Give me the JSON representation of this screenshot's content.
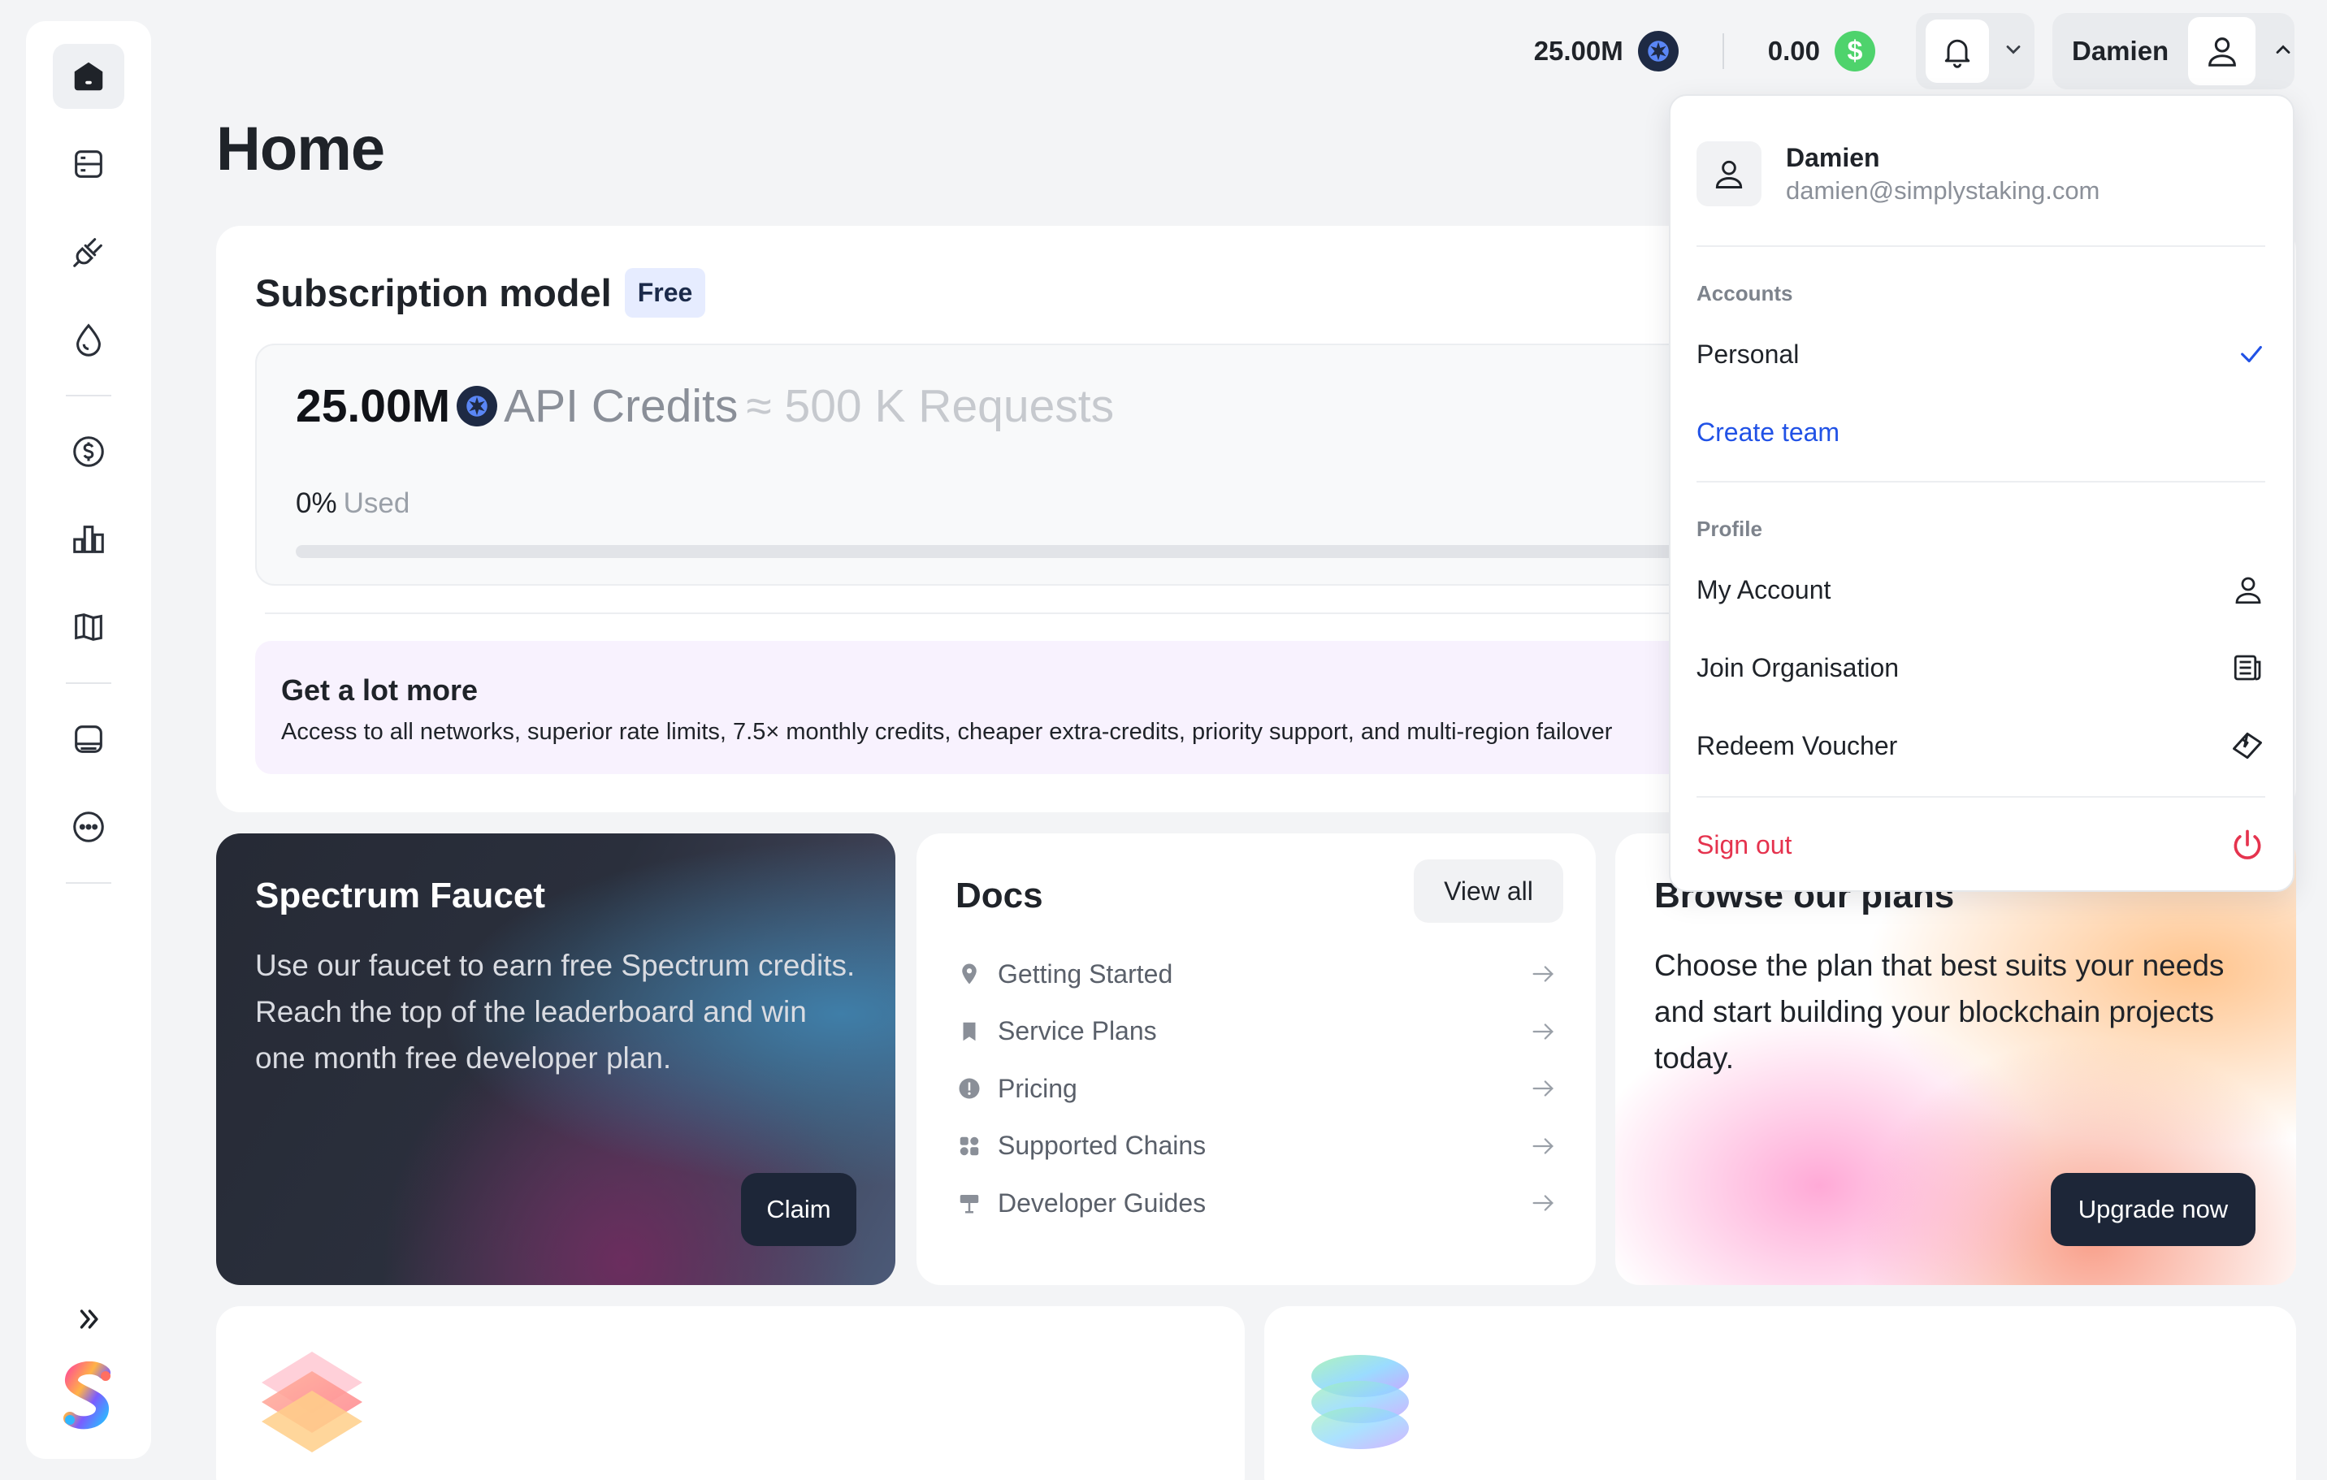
{
  "topbar": {
    "credits_value": "25.00M",
    "balance_value": "0.00",
    "balance_symbol": "$",
    "user_name": "Damien"
  },
  "page": {
    "title": "Home"
  },
  "subscription": {
    "title": "Subscription model",
    "badge": "Free",
    "credits_amount": "25.00M",
    "credits_label": "API Credits",
    "requests_label": "≈ 500 K Requests",
    "used_percent": "0%",
    "used_label": "Used",
    "used_fraction": 0,
    "promo_title": "Get a lot more",
    "promo_text": "Access to all networks, superior rate limits, 7.5× monthly credits, cheaper extra-credits, priority support, and multi-region failover"
  },
  "faucet": {
    "title": "Spectrum Faucet",
    "text": "Use our faucet to earn free Spectrum credits. Reach the top of the leaderboard and win one month free developer plan.",
    "button": "Claim"
  },
  "docs": {
    "title": "Docs",
    "view_all": "View all",
    "items": [
      {
        "label": "Getting Started",
        "icon": "location-pin-icon"
      },
      {
        "label": "Service Plans",
        "icon": "bookmark-icon"
      },
      {
        "label": "Pricing",
        "icon": "info-icon"
      },
      {
        "label": "Supported Chains",
        "icon": "grid-icon"
      },
      {
        "label": "Developer Guides",
        "icon": "signpost-icon"
      }
    ]
  },
  "plans": {
    "title": "Browse our plans",
    "text": "Choose the plan that best suits your needs and start building your blockchain projects today.",
    "button": "Upgrade now"
  },
  "dropdown": {
    "name": "Damien",
    "email": "damien@simplystaking.com",
    "accounts_label": "Accounts",
    "personal": "Personal",
    "create_team": "Create team",
    "profile_label": "Profile",
    "my_account": "My Account",
    "join_org": "Join Organisation",
    "redeem": "Redeem Voucher",
    "sign_out": "Sign out"
  },
  "colors": {
    "accent_blue": "#2152e6",
    "danger": "#e5334e",
    "coin_green": "#4ed36c",
    "dark_button": "#1d2638",
    "promo_bg": "#f8f2fe"
  }
}
